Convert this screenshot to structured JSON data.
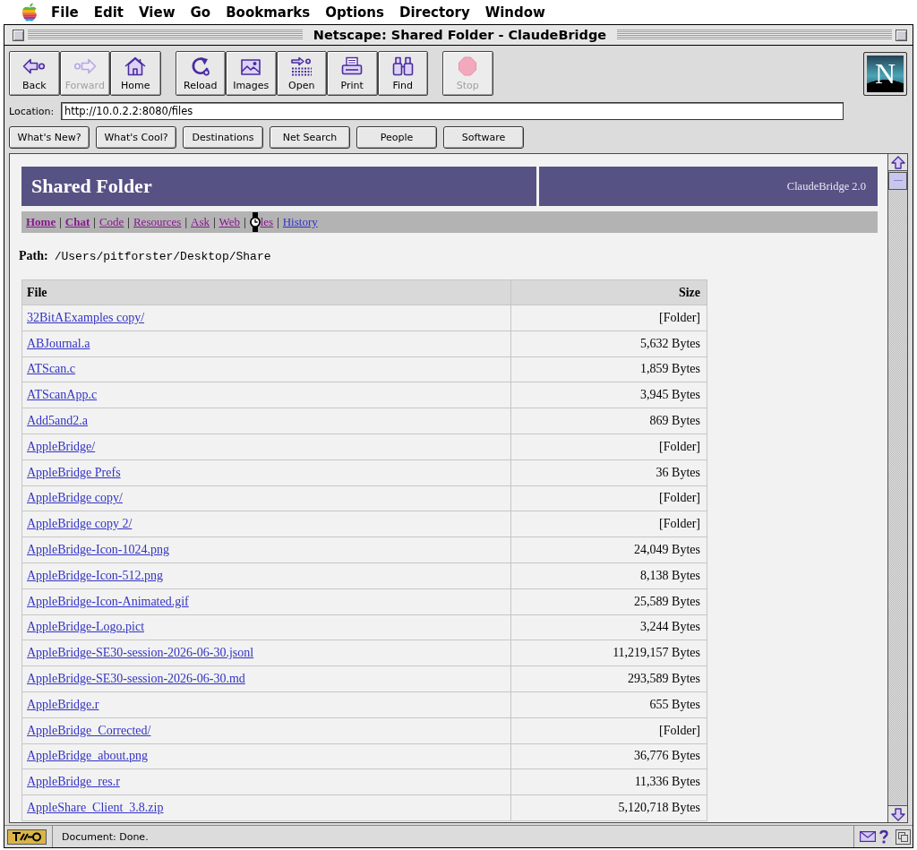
{
  "menu_bar": {
    "items": [
      "File",
      "Edit",
      "View",
      "Go",
      "Bookmarks",
      "Options",
      "Directory",
      "Window"
    ]
  },
  "window": {
    "title": "Netscape: Shared Folder - ClaudeBridge"
  },
  "toolbar": {
    "groups": [
      {
        "buttons": [
          {
            "kind": "back",
            "label": "Back",
            "disabled": false
          },
          {
            "kind": "forward",
            "label": "Forward",
            "disabled": true
          },
          {
            "kind": "home",
            "label": "Home",
            "disabled": false
          }
        ]
      },
      {
        "buttons": [
          {
            "kind": "reload",
            "label": "Reload",
            "disabled": false
          },
          {
            "kind": "images",
            "label": "Images",
            "disabled": false
          },
          {
            "kind": "open",
            "label": "Open",
            "disabled": false
          },
          {
            "kind": "print",
            "label": "Print",
            "disabled": false
          },
          {
            "kind": "find",
            "label": "Find",
            "disabled": false
          }
        ]
      },
      {
        "buttons": [
          {
            "kind": "stop",
            "label": "Stop",
            "disabled": true
          }
        ]
      }
    ],
    "logo": "N"
  },
  "location": {
    "label": "Location:",
    "value": "http://10.0.2.2:8080/files"
  },
  "directory_buttons": [
    "What's New?",
    "What's Cool?",
    "Destinations",
    "Net Search",
    "People",
    "Software"
  ],
  "page": {
    "title": "Shared Folder",
    "version": "ClaudeBridge 2.0",
    "nav": {
      "separator": "|",
      "links": [
        {
          "label": "Home",
          "bold": true,
          "visited": true,
          "cursor_over": false
        },
        {
          "label": "Chat",
          "bold": true,
          "visited": true,
          "cursor_over": false
        },
        {
          "label": "Code",
          "bold": false,
          "visited": true,
          "cursor_over": false
        },
        {
          "label": "Resources",
          "bold": false,
          "visited": true,
          "cursor_over": false
        },
        {
          "label": "Ask",
          "bold": false,
          "visited": true,
          "cursor_over": false
        },
        {
          "label": "Web",
          "bold": false,
          "visited": true,
          "cursor_over": false
        },
        {
          "label": "les",
          "bold": false,
          "visited": true,
          "cursor_over": true
        },
        {
          "label": "History",
          "bold": false,
          "visited": false,
          "cursor_over": false
        }
      ]
    },
    "path": {
      "label": "Path:",
      "value": "/Users/pitforster/Desktop/Share"
    },
    "table": {
      "columns": [
        "File",
        "Size"
      ],
      "rows": [
        {
          "name": "32BitAExamples copy/",
          "size": "[Folder]"
        },
        {
          "name": "ABJournal.a",
          "size": "5,632 Bytes"
        },
        {
          "name": "ATScan.c",
          "size": "1,859 Bytes"
        },
        {
          "name": "ATScanApp.c",
          "size": "3,945 Bytes"
        },
        {
          "name": "Add5and2.a",
          "size": "869 Bytes"
        },
        {
          "name": "AppleBridge/",
          "size": "[Folder]"
        },
        {
          "name": "AppleBridge Prefs",
          "size": "36 Bytes"
        },
        {
          "name": "AppleBridge copy/",
          "size": "[Folder]"
        },
        {
          "name": "AppleBridge copy 2/",
          "size": "[Folder]"
        },
        {
          "name": "AppleBridge-Icon-1024.png",
          "size": "24,049 Bytes"
        },
        {
          "name": "AppleBridge-Icon-512.png",
          "size": "8,138 Bytes"
        },
        {
          "name": "AppleBridge-Icon-Animated.gif",
          "size": "25,589 Bytes"
        },
        {
          "name": "AppleBridge-Logo.pict",
          "size": "3,244 Bytes"
        },
        {
          "name": "AppleBridge-SE30-session-2026-06-30.jsonl",
          "size": "11,219,157 Bytes"
        },
        {
          "name": "AppleBridge-SE30-session-2026-06-30.md",
          "size": "293,589 Bytes"
        },
        {
          "name": "AppleBridge.r",
          "size": "655 Bytes"
        },
        {
          "name": "AppleBridge_Corrected/",
          "size": "[Folder]"
        },
        {
          "name": "AppleBridge_about.png",
          "size": "36,776 Bytes"
        },
        {
          "name": "AppleBridge_res.r",
          "size": "11,336 Bytes"
        },
        {
          "name": "AppleShare_Client_3.8.zip",
          "size": "5,120,718 Bytes"
        }
      ]
    }
  },
  "status_bar": {
    "text": "Document: Done."
  }
}
